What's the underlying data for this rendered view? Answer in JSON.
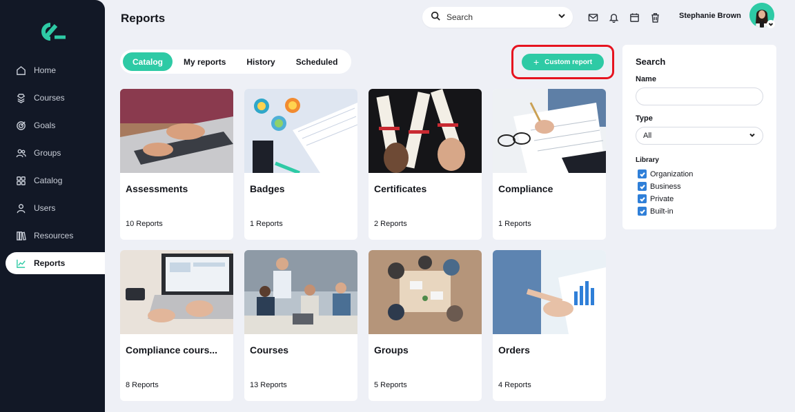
{
  "sidebar": {
    "items": [
      {
        "label": "Home",
        "icon": "home-icon"
      },
      {
        "label": "Courses",
        "icon": "courses-icon"
      },
      {
        "label": "Goals",
        "icon": "target-icon"
      },
      {
        "label": "Groups",
        "icon": "users-icon"
      },
      {
        "label": "Catalog",
        "icon": "grid-icon"
      },
      {
        "label": "Users",
        "icon": "user-icon"
      },
      {
        "label": "Resources",
        "icon": "books-icon"
      },
      {
        "label": "Reports",
        "icon": "chart-icon"
      }
    ],
    "active_index": 7
  },
  "header": {
    "title": "Reports",
    "search_placeholder": "Search",
    "user_name": "Stephanie Brown"
  },
  "tabs": [
    {
      "label": "Catalog"
    },
    {
      "label": "My reports"
    },
    {
      "label": "History"
    },
    {
      "label": "Scheduled"
    }
  ],
  "custom_report_label": "Custom report",
  "cards": [
    {
      "title": "Assessments",
      "count": "10 Reports"
    },
    {
      "title": "Badges",
      "count": "1 Reports"
    },
    {
      "title": "Certificates",
      "count": "2 Reports"
    },
    {
      "title": "Compliance",
      "count": "1 Reports"
    },
    {
      "title": "Compliance cours...",
      "count": "8 Reports"
    },
    {
      "title": "Courses",
      "count": "13 Reports"
    },
    {
      "title": "Groups",
      "count": "5 Reports"
    },
    {
      "title": "Orders",
      "count": "4 Reports"
    }
  ],
  "search_panel": {
    "title": "Search",
    "name_label": "Name",
    "type_label": "Type",
    "type_value": "All",
    "library_label": "Library",
    "library_options": [
      {
        "label": "Organization",
        "checked": true
      },
      {
        "label": "Business",
        "checked": true
      },
      {
        "label": "Private",
        "checked": true
      },
      {
        "label": "Built-in",
        "checked": true
      }
    ]
  },
  "colors": {
    "accent": "#2ecaa5",
    "sidebar_bg": "#121826",
    "page_bg": "#eef0f6",
    "highlight": "#e6131f",
    "checkbox": "#2f7fd8"
  }
}
